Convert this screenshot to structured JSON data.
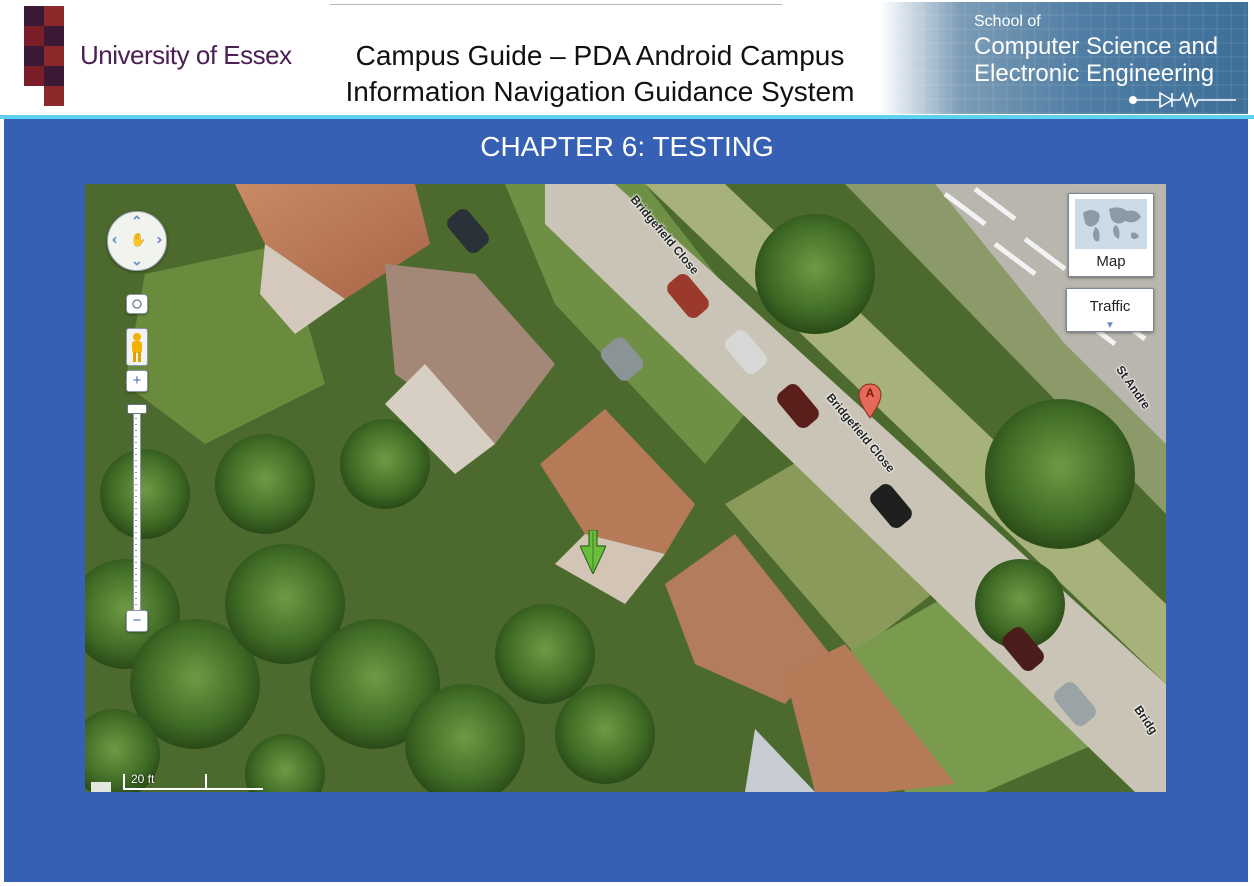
{
  "header": {
    "university": "University of Essex",
    "title_line1": "Campus Guide – PDA Android Campus",
    "title_line2": "Information Navigation Guidance System",
    "school_of": "School of",
    "school_line1": "Computer Science and",
    "school_line2": "Electronic Engineering"
  },
  "slide": {
    "chapter_title": "CHAPTER 6: TESTING"
  },
  "map": {
    "map_type_label": "Map",
    "traffic_label": "Traffic",
    "marker_letter": "A",
    "scale_label": "20 ft",
    "streets": [
      {
        "name": "Bridgefield Close"
      },
      {
        "name": "Bridgefield Close"
      },
      {
        "name": "St Andre"
      },
      {
        "name": "Bridg"
      }
    ],
    "controls": {
      "pan_icon": "pan-hand-icon",
      "street_view_icon": "pegman-icon",
      "zoom_in": "+",
      "zoom_out": "−"
    }
  },
  "colors": {
    "slide_background": "#3560b4",
    "header_rule": "#5ed0f0",
    "university_purple": "#4a2055",
    "logo_maroon": "#7a1f2a",
    "marker_red": "#e66a5a",
    "location_arrow_green": "#6bbd3e"
  }
}
